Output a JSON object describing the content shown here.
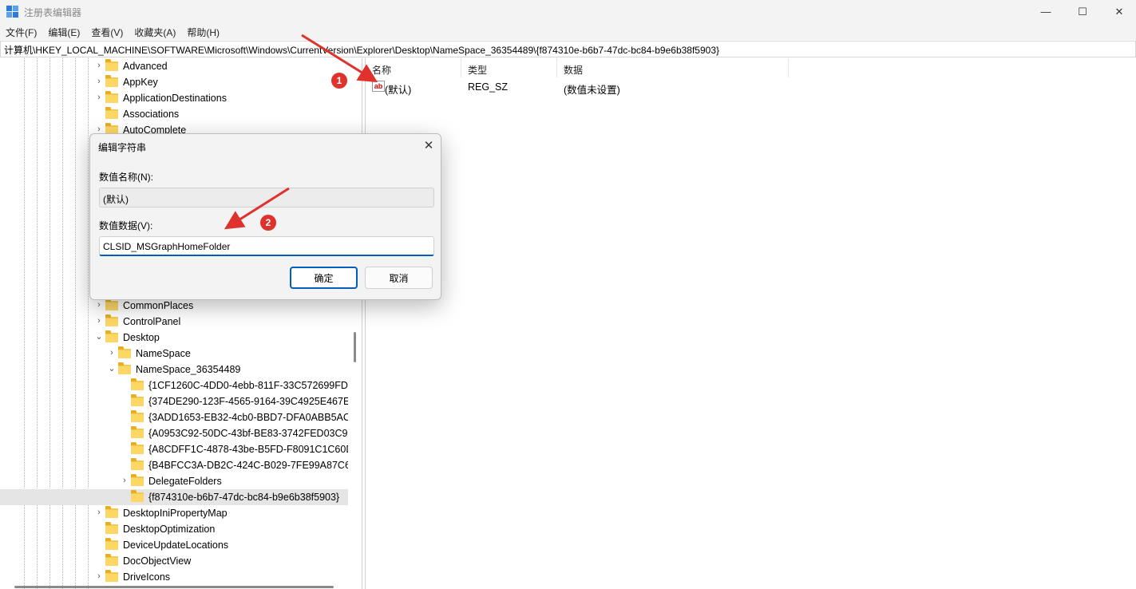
{
  "window": {
    "title": "注册表编辑器",
    "minimize_icon": "—",
    "maximize_icon": "☐",
    "close_icon": "✕"
  },
  "menu": [
    "文件(F)",
    "编辑(E)",
    "查看(V)",
    "收藏夹(A)",
    "帮助(H)"
  ],
  "address": "计算机\\HKEY_LOCAL_MACHINE\\SOFTWARE\\Microsoft\\Windows\\CurrentVersion\\Explorer\\Desktop\\NameSpace_36354489\\{f874310e-b6b7-47dc-bc84-b9e6b38f5903}",
  "tree": {
    "items": [
      {
        "label": "Advanced",
        "expander": "›"
      },
      {
        "label": "AppKey",
        "expander": "›"
      },
      {
        "label": "ApplicationDestinations",
        "expander": "›"
      },
      {
        "label": "Associations",
        "expander": ""
      },
      {
        "label": "AutoComplete",
        "expander": "›"
      },
      {
        "label": "CommonPlaces",
        "expander": "›"
      },
      {
        "label": "ControlPanel",
        "expander": "›"
      },
      {
        "label": "Desktop",
        "expander": "⌄"
      },
      {
        "label": "NameSpace",
        "expander": "›"
      },
      {
        "label": "NameSpace_36354489",
        "expander": "⌄"
      },
      {
        "label": "{1CF1260C-4DD0-4ebb-811F-33C572699FD",
        "expander": ""
      },
      {
        "label": "{374DE290-123F-4565-9164-39C4925E467E",
        "expander": ""
      },
      {
        "label": "{3ADD1653-EB32-4cb0-BBD7-DFA0ABB5AC",
        "expander": ""
      },
      {
        "label": "{A0953C92-50DC-43bf-BE83-3742FED03C9",
        "expander": ""
      },
      {
        "label": "{A8CDFF1C-4878-43be-B5FD-F8091C1C60D",
        "expander": ""
      },
      {
        "label": "{B4BFCC3A-DB2C-424C-B029-7FE99A87C64",
        "expander": ""
      },
      {
        "label": "DelegateFolders",
        "expander": "›"
      },
      {
        "label": "{f874310e-b6b7-47dc-bc84-b9e6b38f5903}",
        "expander": ""
      },
      {
        "label": "DesktopIniPropertyMap",
        "expander": "›"
      },
      {
        "label": "DesktopOptimization",
        "expander": ""
      },
      {
        "label": "DeviceUpdateLocations",
        "expander": ""
      },
      {
        "label": "DocObjectView",
        "expander": ""
      },
      {
        "label": "DriveIcons",
        "expander": "›"
      }
    ]
  },
  "list": {
    "columns": [
      "名称",
      "类型",
      "数据"
    ],
    "rows": [
      {
        "icon": "ab",
        "name": "(默认)",
        "type": "REG_SZ",
        "data": "(数值未设置)"
      }
    ]
  },
  "dialog": {
    "title": "编辑字符串",
    "close_icon": "✕",
    "name_label": "数值名称(N):",
    "name_value": "(默认)",
    "data_label": "数值数据(V):",
    "data_value": "CLSID_MSGraphHomeFolder",
    "ok_label": "确定",
    "cancel_label": "取消"
  },
  "annotations": {
    "badge1": "1",
    "badge2": "2",
    "arrow_color": "#e0322c"
  }
}
